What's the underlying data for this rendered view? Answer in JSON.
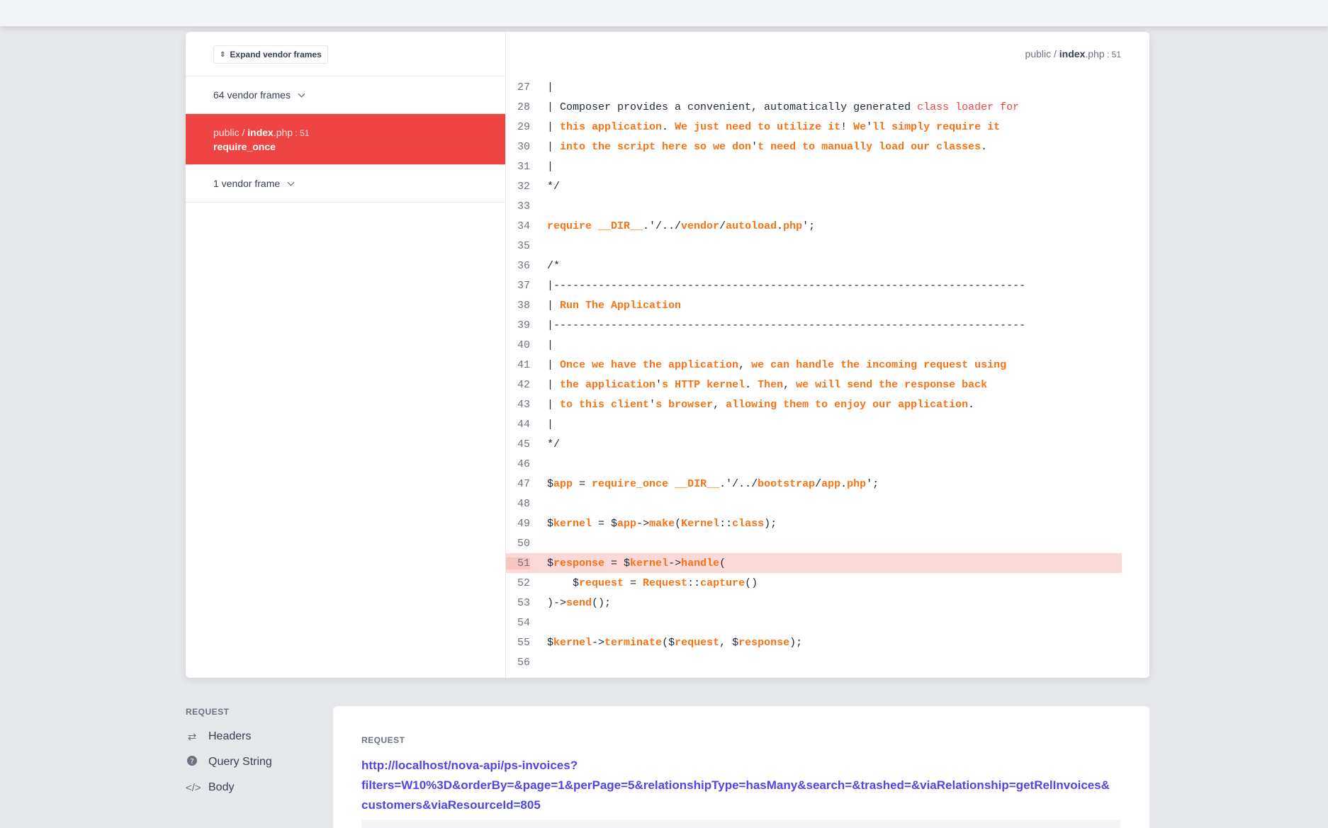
{
  "sidebar": {
    "expand_button": "Expand vendor frames",
    "group1": "64 vendor frames",
    "active_frame": {
      "dir": "public / ",
      "file": "index",
      "ext": ".php",
      "sep": " : ",
      "line": "51",
      "function": "require_once"
    },
    "group2": "1 vendor frame"
  },
  "file_header": {
    "dir": "public / ",
    "file": "index",
    "ext": ".php",
    "sep": " : ",
    "line": "51"
  },
  "code_lines": [
    {
      "n": "27"
    },
    {
      "n": "28"
    },
    {
      "n": "29"
    },
    {
      "n": "30"
    },
    {
      "n": "31"
    },
    {
      "n": "32"
    },
    {
      "n": "33"
    },
    {
      "n": "34"
    },
    {
      "n": "35"
    },
    {
      "n": "36"
    },
    {
      "n": "37"
    },
    {
      "n": "38"
    },
    {
      "n": "39"
    },
    {
      "n": "40"
    },
    {
      "n": "41"
    },
    {
      "n": "42"
    },
    {
      "n": "43"
    },
    {
      "n": "44"
    },
    {
      "n": "45"
    },
    {
      "n": "46"
    },
    {
      "n": "47"
    },
    {
      "n": "48"
    },
    {
      "n": "49"
    },
    {
      "n": "50"
    },
    {
      "n": "51"
    },
    {
      "n": "52"
    },
    {
      "n": "53"
    },
    {
      "n": "54"
    },
    {
      "n": "55"
    },
    {
      "n": "56"
    }
  ],
  "code_text": {
    "l28a": "| Composer provides a convenient, automatically generated ",
    "l28b": "class loader for",
    "l29a": "| ",
    "l29b": "this application",
    "l29c": ". ",
    "l29d": "We just need to utilize it",
    "l29e": "! ",
    "l29f": "We",
    "l29g": "'",
    "l29h": "ll simply require it",
    "l30a": "| ",
    "l30b": "into the script here so we don",
    "l30c": "'",
    "l30d": "t need to manually load our classes",
    "l30e": ".",
    "l31": "|",
    "l32": "*/",
    "l27": "|",
    "l34a": "require __DIR__",
    "l34b": ".'/../",
    "l34c": "vendor",
    "l34d": "/",
    "l34e": "autoload",
    "l34f": ".",
    "l34g": "php",
    "l34h": "';",
    "l36": "/*",
    "l37": "|--------------------------------------------------------------------------",
    "l38a": "| ",
    "l38b": "Run The Application",
    "l39": "|--------------------------------------------------------------------------",
    "l40": "|",
    "l41a": "| ",
    "l41b": "Once we have the application",
    "l41c": ", ",
    "l41d": "we can handle the incoming request using",
    "l42a": "| ",
    "l42b": "the application",
    "l42c": "'",
    "l42d": "s HTTP kernel",
    "l42e": ". ",
    "l42f": "Then",
    "l42g": ", ",
    "l42h": "we will send the response back",
    "l43a": "| ",
    "l43b": "to this client",
    "l43c": "'",
    "l43d": "s browser",
    "l43e": ", ",
    "l43f": "allowing them to enjoy our application",
    "l43g": ".",
    "l44": "|",
    "l45": "*/",
    "l47a": "$",
    "l47b": "app",
    "l47c": " = ",
    "l47d": "require_once __DIR__",
    "l47e": ".'/../",
    "l47f": "bootstrap",
    "l47g": "/",
    "l47h": "app",
    "l47i": ".",
    "l47j": "php",
    "l47k": "';",
    "l49a": "$",
    "l49b": "kernel",
    "l49c": " = $",
    "l49d": "app",
    "l49e": "->",
    "l49f": "make",
    "l49g": "(",
    "l49h": "Kernel",
    "l49i": "::",
    "l49j": "class",
    "l49k": ");",
    "l51a": "$",
    "l51b": "response",
    "l51c": " = $",
    "l51d": "kernel",
    "l51e": "->",
    "l51f": "handle",
    "l51g": "(",
    "l52a": "    $",
    "l52b": "request",
    "l52c": " = ",
    "l52d": "Request",
    "l52e": "::",
    "l52f": "capture",
    "l52g": "()",
    "l53a": ")->",
    "l53b": "send",
    "l53c": "();",
    "l55a": "$",
    "l55b": "kernel",
    "l55c": "->",
    "l55d": "terminate",
    "l55e": "($",
    "l55f": "request",
    "l55g": ", $",
    "l55h": "response",
    "l55i": ");"
  },
  "request_nav": {
    "label": "REQUEST",
    "items": [
      {
        "label": "Headers",
        "icon": "arrows-exchange-icon"
      },
      {
        "label": "Query String",
        "icon": "question-circle-icon"
      },
      {
        "label": "Body",
        "icon": "code-icon"
      }
    ]
  },
  "request_card": {
    "label": "REQUEST",
    "url_line1": "http://localhost/nova-api/ps-invoices?",
    "url_line2": "filters=W10%3D&orderBy=&page=1&perPage=5&relationshipType=hasMany&search=&trashed=&viaRelationship=getRelInvoices&",
    "url_line3": "customers&viaResourceId=805"
  },
  "colors": {
    "accent": "#ef4444",
    "keyword": "#f97316",
    "link": "#4f46e5"
  }
}
